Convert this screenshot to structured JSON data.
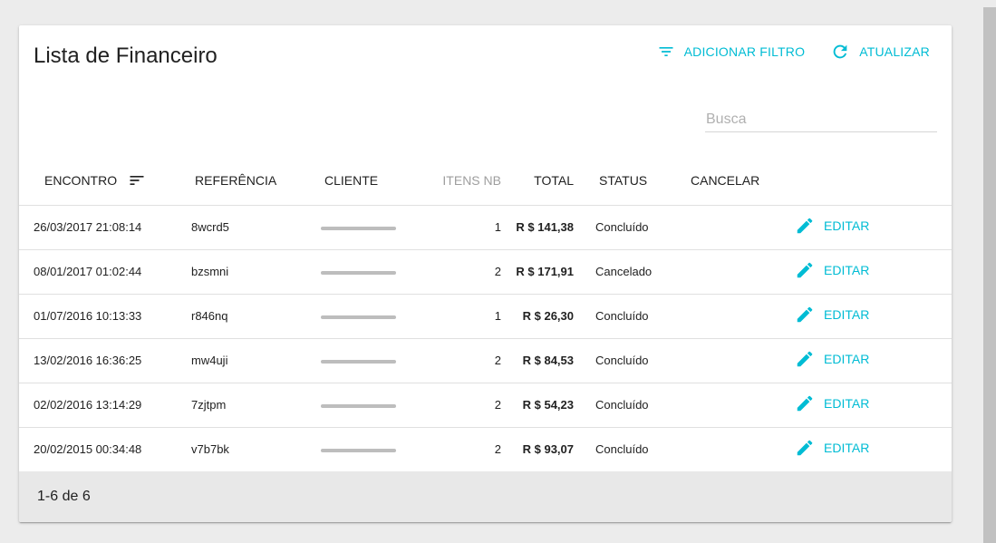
{
  "page": {
    "title": "Lista de Financeiro"
  },
  "toolbar": {
    "add_filter": "ADICIONAR FILTRO",
    "refresh": "ATUALIZAR"
  },
  "search": {
    "placeholder": "Busca",
    "value": ""
  },
  "columns": {
    "encontro": "ENCONTRO",
    "referencia": "REFERÊNCIA",
    "cliente": "CLIENTE",
    "itens": "ITENS NB",
    "total": "TOTAL",
    "status": "STATUS",
    "cancelar": "CANCELAR"
  },
  "rows": [
    {
      "date": "26/03/2017 21:08:14",
      "ref": "8wcrd5",
      "items": "1",
      "total": "R $ 141,38",
      "status": "Concluído",
      "edit": "EDITAR"
    },
    {
      "date": "08/01/2017 01:02:44",
      "ref": "bzsmni",
      "items": "2",
      "total": "R $ 171,91",
      "status": "Cancelado",
      "edit": "EDITAR"
    },
    {
      "date": "01/07/2016 10:13:33",
      "ref": "r846nq",
      "items": "1",
      "total": "R $ 26,30",
      "status": "Concluído",
      "edit": "EDITAR"
    },
    {
      "date": "13/02/2016 16:36:25",
      "ref": "mw4uji",
      "items": "2",
      "total": "R $ 84,53",
      "status": "Concluído",
      "edit": "EDITAR"
    },
    {
      "date": "02/02/2016 13:14:29",
      "ref": "7zjtpm",
      "items": "2",
      "total": "R $ 54,23",
      "status": "Concluído",
      "edit": "EDITAR"
    },
    {
      "date": "20/02/2015 00:34:48",
      "ref": "v7b7bk",
      "items": "2",
      "total": "R $ 93,07",
      "status": "Concluído",
      "edit": "EDITAR"
    }
  ],
  "pagination": {
    "label": "1-6 de 6"
  },
  "colors": {
    "accent": "#00bcd4",
    "footer_bg": "#e8e8e8"
  }
}
